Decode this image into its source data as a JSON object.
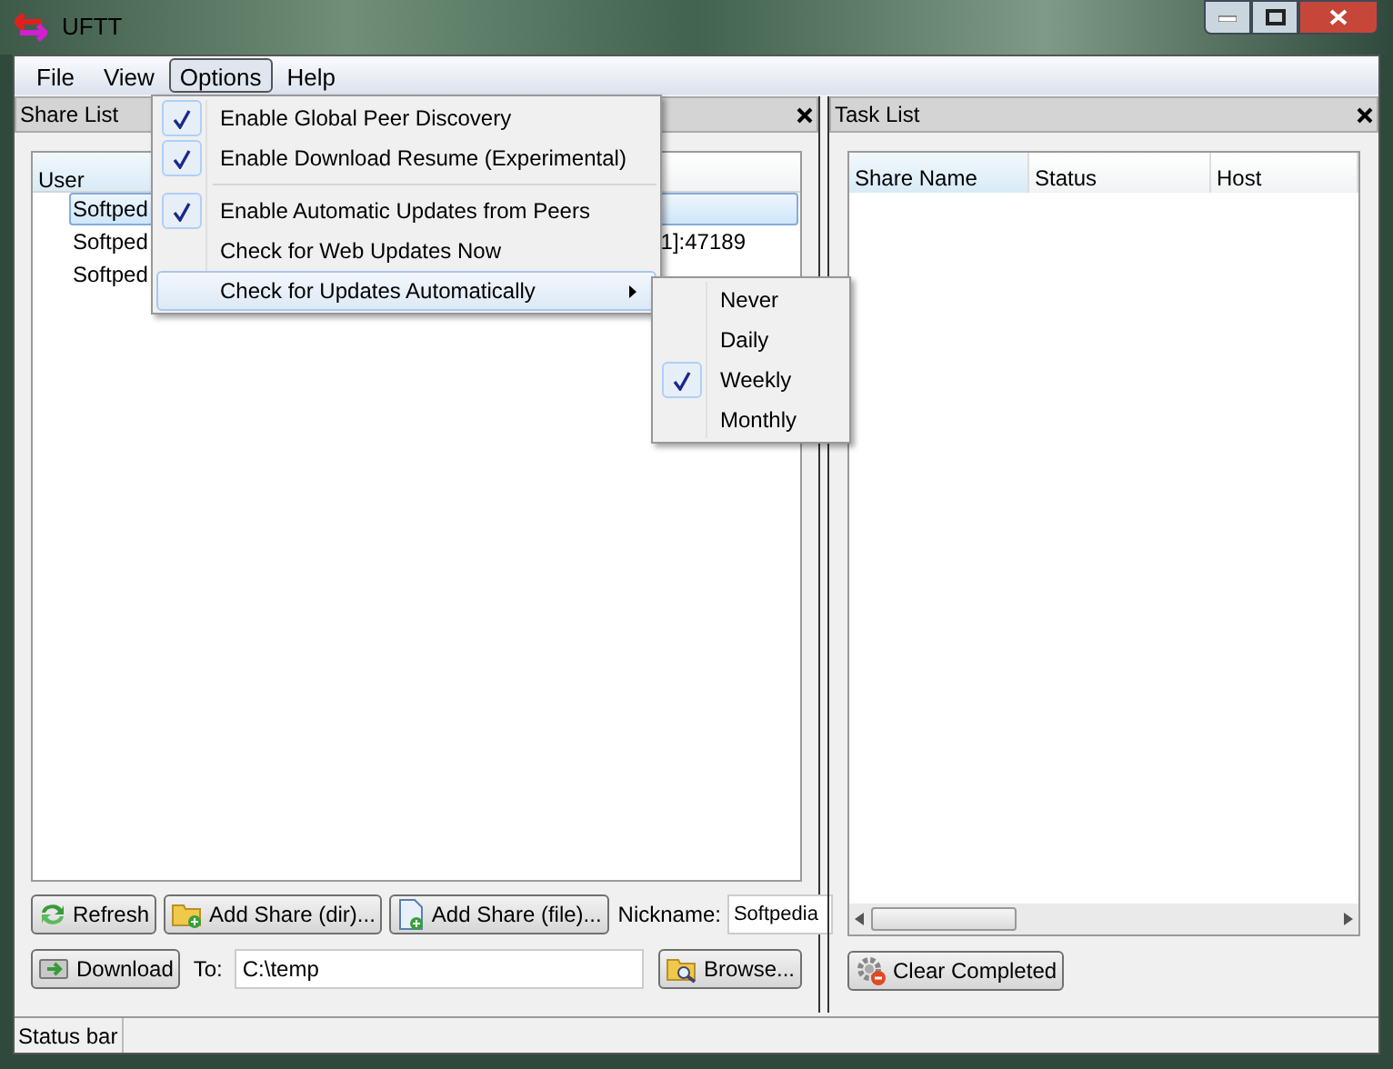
{
  "window": {
    "title": "UFTT"
  },
  "menu": [
    {
      "label": "File",
      "selected": false
    },
    {
      "label": "View",
      "selected": false
    },
    {
      "label": "Options",
      "selected": true
    },
    {
      "label": "Help",
      "selected": false
    }
  ],
  "options_menu": {
    "items": [
      {
        "kind": "check",
        "label": "Enable Global Peer Discovery",
        "checked": true,
        "selected": false
      },
      {
        "kind": "check",
        "label": "Enable Download Resume (Experimental)",
        "checked": true,
        "selected": false
      },
      {
        "kind": "separator"
      },
      {
        "kind": "check",
        "label": "Enable Automatic Updates from Peers",
        "checked": true,
        "selected": false
      },
      {
        "kind": "check",
        "label": "Check for Web Updates Now",
        "checked": false,
        "selected": false
      },
      {
        "kind": "submenu",
        "label": "Check for Updates Automatically",
        "checked": false,
        "selected": true
      }
    ]
  },
  "submenu": {
    "items": [
      {
        "label": "Never",
        "checked": false
      },
      {
        "label": "Daily",
        "checked": false
      },
      {
        "label": "Weekly",
        "checked": true
      },
      {
        "label": "Monthly",
        "checked": false
      }
    ]
  },
  "share_list": {
    "title": "Share List",
    "columns": [
      "User"
    ],
    "rows": [
      {
        "cells": [
          "Softped"
        ],
        "selected": true
      },
      {
        "cells": [
          "Softped",
          "1]:47189"
        ],
        "selected": false
      },
      {
        "cells": [
          "Softped"
        ],
        "selected": false
      }
    ],
    "buttons": [
      {
        "kind": "refresh",
        "label": "Refresh"
      },
      {
        "kind": "dir",
        "label": "Add Share (dir)..."
      },
      {
        "kind": "file",
        "label": "Add Share (file)..."
      }
    ],
    "nickname": {
      "label": "Nickname:",
      "value": "Softpedia"
    },
    "download_button": "Download",
    "to": {
      "label": "To:",
      "value": "C:\\temp"
    },
    "browse_button": "Browse..."
  },
  "task_list": {
    "title": "Task List",
    "columns": [
      "Share Name",
      "Status",
      "Host"
    ],
    "clear_button": "Clear Completed"
  },
  "status_bar": "Status bar"
}
